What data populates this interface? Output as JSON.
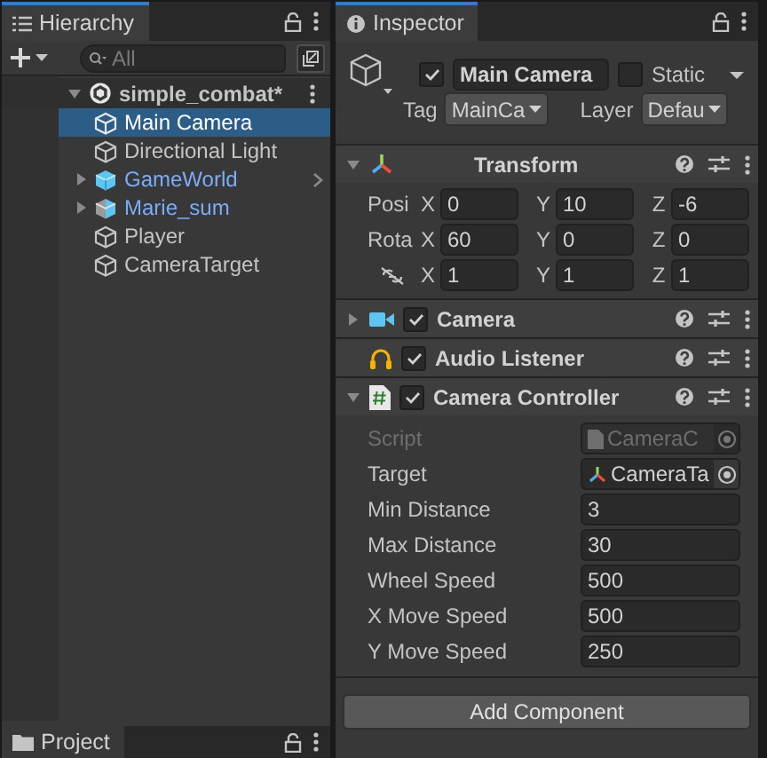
{
  "hierarchy": {
    "title": "Hierarchy",
    "search": {
      "placeholder": "All"
    },
    "scene": {
      "name": "simple_combat*",
      "expanded": true,
      "children": [
        {
          "name": "Main Camera",
          "kind": "object",
          "selected": true
        },
        {
          "name": "Directional Light",
          "kind": "object",
          "selected": false
        },
        {
          "name": "GameWorld",
          "kind": "prefab",
          "selected": false,
          "expanded": false
        },
        {
          "name": "Marie_sum",
          "kind": "model",
          "selected": false,
          "expanded": false
        },
        {
          "name": "Player",
          "kind": "object",
          "selected": false
        },
        {
          "name": "CameraTarget",
          "kind": "object",
          "selected": false
        }
      ]
    }
  },
  "project_tab": {
    "title": "Project"
  },
  "inspector": {
    "title": "Inspector",
    "object": {
      "active": true,
      "name": "Main Camera",
      "static": false,
      "static_label": "Static",
      "tag_label": "Tag",
      "tag": "MainCa",
      "layer_label": "Layer",
      "layer": "Defau"
    },
    "transform": {
      "name": "Transform",
      "expanded": true,
      "rows": [
        {
          "kind": "text",
          "label": "Posi",
          "fields": [
            {
              "axis": "X",
              "value": "0"
            },
            {
              "axis": "Y",
              "value": "10"
            },
            {
              "axis": "Z",
              "value": "-6"
            }
          ]
        },
        {
          "kind": "text",
          "label": "Rota",
          "fields": [
            {
              "axis": "X",
              "value": "60"
            },
            {
              "axis": "Y",
              "value": "0"
            },
            {
              "axis": "Z",
              "value": "0"
            }
          ]
        },
        {
          "kind": "icon",
          "fields": [
            {
              "axis": "X",
              "value": "1"
            },
            {
              "axis": "Y",
              "value": "1"
            },
            {
              "axis": "Z",
              "value": "1"
            }
          ]
        }
      ]
    },
    "components": [
      {
        "name": "Camera",
        "kind": "camera",
        "enabled": true,
        "expanded": false
      },
      {
        "name": "Audio Listener",
        "kind": "audio",
        "enabled": true
      },
      {
        "name": "Camera Controller",
        "kind": "script",
        "enabled": true,
        "expanded": true,
        "properties": [
          {
            "label": "Script",
            "kind": "script",
            "value": "CameraC",
            "disabled": true
          },
          {
            "label": "Target",
            "kind": "target",
            "value": "CameraTa",
            "disabled": false
          },
          {
            "label": "Min Distance",
            "kind": "number",
            "value": "3",
            "disabled": false
          },
          {
            "label": "Max Distance",
            "kind": "number",
            "value": "30",
            "disabled": false
          },
          {
            "label": "Wheel Speed",
            "kind": "number",
            "value": "500",
            "disabled": false
          },
          {
            "label": "X Move Speed",
            "kind": "number",
            "value": "500",
            "disabled": false
          },
          {
            "label": "Y Move Speed",
            "kind": "number",
            "value": "250",
            "disabled": false
          }
        ]
      }
    ],
    "add_button": "Add Component"
  }
}
